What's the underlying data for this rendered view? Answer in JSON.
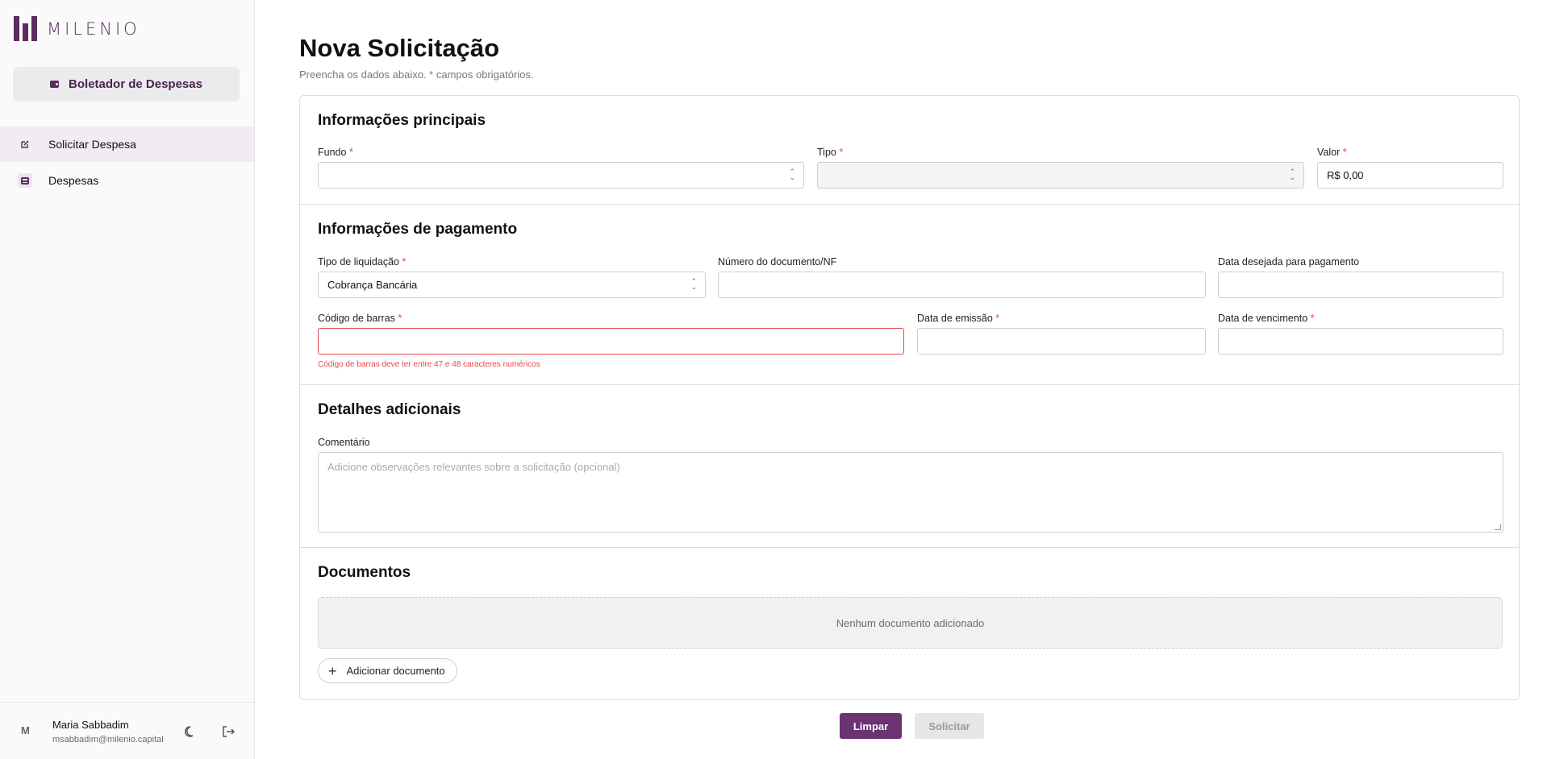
{
  "sidebar": {
    "logo_text": "MILENIO",
    "app_name": "Boletador de Despesas",
    "items": [
      {
        "label": "Solicitar Despesa",
        "icon": "edit-icon",
        "active": true
      },
      {
        "label": "Despesas",
        "icon": "inbox-icon",
        "active": false
      }
    ],
    "user": {
      "initial": "M",
      "name": "Maria Sabbadim",
      "email": "msabbadim@milenio.capital"
    }
  },
  "page": {
    "title": "Nova Solicitação",
    "subtitle": "Preencha os dados abaixo. * campos obrigatórios."
  },
  "form": {
    "main_info": {
      "title": "Informações principais",
      "fundo_label": "Fundo",
      "fundo_value": "",
      "tipo_label": "Tipo",
      "tipo_value": "",
      "valor_label": "Valor",
      "valor_value": "R$ 0,00"
    },
    "payment_info": {
      "title": "Informações de pagamento",
      "tipo_liquidacao_label": "Tipo de liquidação",
      "tipo_liquidacao_value": "Cobrança Bancária",
      "numero_doc_label": "Número do documento/NF",
      "numero_doc_value": "",
      "data_desejada_label": "Data desejada para pagamento",
      "data_desejada_value": "",
      "codigo_barras_label": "Código de barras",
      "codigo_barras_value": "",
      "codigo_barras_error": "Código de barras deve ter entre 47 e 48 caracteres numéricos",
      "data_emissao_label": "Data de emissão",
      "data_emissao_value": "",
      "data_vencimento_label": "Data de vencimento",
      "data_vencimento_value": ""
    },
    "details": {
      "title": "Detalhes adicionais",
      "comentario_label": "Comentário",
      "comentario_placeholder": "Adicione observações relevantes sobre a solicitação (opcional)"
    },
    "documents": {
      "title": "Documentos",
      "empty_text": "Nenhum documento adicionado",
      "add_label": "Adicionar documento"
    },
    "required_mark": "*"
  },
  "actions": {
    "clear_label": "Limpar",
    "submit_label": "Solicitar"
  },
  "colors": {
    "brand": "#5b2d5e",
    "primary_button": "#6b3372",
    "error": "#e5484d"
  }
}
